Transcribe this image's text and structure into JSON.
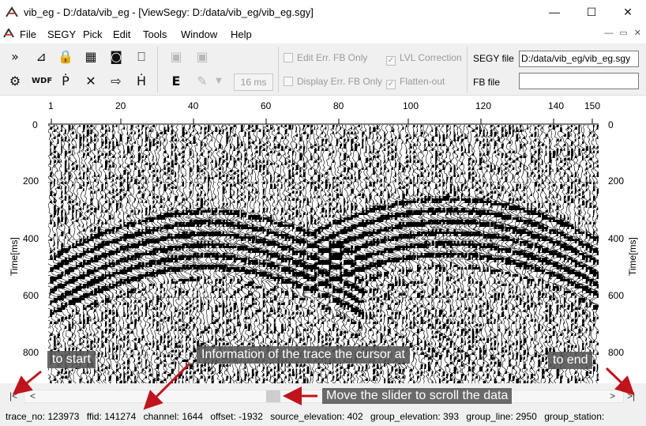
{
  "window": {
    "title": "vib_eg - D:/data/vib_eg - [ViewSegy: D:/data/vib_eg/vib_eg.sgy]",
    "minimize": "—",
    "maximize": "☐",
    "close": "✕"
  },
  "menu": {
    "items": [
      "File",
      "SEGY",
      "Pick",
      "Edit",
      "Tools",
      "Window",
      "Help"
    ]
  },
  "toolbar": {
    "ms_value": "16 ms",
    "checkboxes": {
      "edit_err_fb_only": "Edit Err. FB Only",
      "display_err_fb_only": "Display Err. FB Only",
      "lvl_correction": "LVL Correction",
      "flatten_out": "Flatten-out"
    },
    "segy_file_label": "SEGY file",
    "segy_file_value": "D:/data/vib_eg/vib_eg.sgy",
    "fb_file_label": "FB file",
    "fb_file_value": ""
  },
  "plot": {
    "x_ticks": [
      "1",
      "20",
      "40",
      "60",
      "80",
      "100",
      "120",
      "140",
      "150"
    ],
    "y_ticks": [
      "0",
      "200",
      "400",
      "600",
      "800"
    ],
    "y_label_left": "Time[ms]",
    "y_label_right": "Time[ms]"
  },
  "scroll": {
    "start_btn": "|<",
    "prev_btn": "<",
    "next_btn": ">",
    "end_btn": ">|"
  },
  "status": {
    "trace_no": "trace_no: 123973",
    "ffid": "ffid: 141274",
    "channel": "channel: 1644",
    "offset": "offset: -1932",
    "source_elevation": "source_elevation: 402",
    "group_elevation": "group_elevation: 393",
    "group_line": "group_line: 2950",
    "group_station": "group_station:"
  },
  "annotations": {
    "to_start": "to start",
    "trace_info": "Information of the trace the cursor at",
    "to_end": "to end",
    "slider": "Move the slider to scroll the data"
  },
  "colors": {
    "arrow": "#c0141c",
    "annotation_bg": "#5b5b5b"
  }
}
